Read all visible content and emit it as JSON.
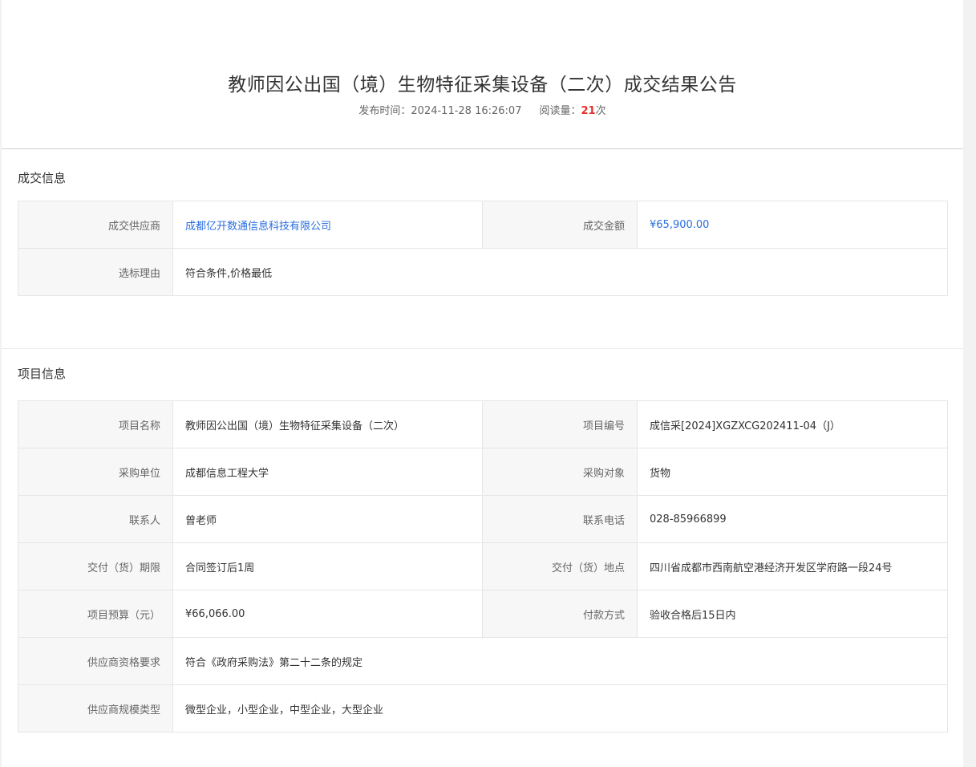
{
  "header": {
    "title": "教师因公出国（境）生物特征采集设备（二次）成交结果公告",
    "publish_label": "发布时间：",
    "publish_time": "2024-11-28 16:26:07",
    "views_label": "阅读量：",
    "views_count": "21",
    "views_suffix": "次"
  },
  "deal_section": {
    "title": "成交信息",
    "supplier_label": "成交供应商",
    "supplier_value": "成都亿开数通信息科技有限公司",
    "amount_label": "成交金额",
    "amount_value": "¥65,900.00",
    "reason_label": "选标理由",
    "reason_value": "符合条件,价格最低"
  },
  "project_section": {
    "title": "项目信息",
    "name_label": "项目名称",
    "name_value": "教师因公出国（境）生物特征采集设备（二次）",
    "code_label": "项目编号",
    "code_value": "成信采[2024]XGZXCG202411-04（J）",
    "unit_label": "采购单位",
    "unit_value": "成都信息工程大学",
    "object_label": "采购对象",
    "object_value": "货物",
    "contact_label": "联系人",
    "contact_value": "曾老师",
    "phone_label": "联系电话",
    "phone_value": "028-85966899",
    "period_label": "交付（货）期限",
    "period_value": "合同签订后1周",
    "place_label": "交付（货）地点",
    "place_value": "四川省成都市西南航空港经济开发区学府路一段24号",
    "budget_label": "项目预算（元）",
    "budget_value": "¥66,066.00",
    "payment_label": "付款方式",
    "payment_value": "验收合格后15日内",
    "qualification_label": "供应商资格要求",
    "qualification_value": "符合《政府采购法》第二十二条的规定",
    "scale_label": "供应商规模类型",
    "scale_value": "微型企业，小型企业，中型企业，大型企业"
  }
}
